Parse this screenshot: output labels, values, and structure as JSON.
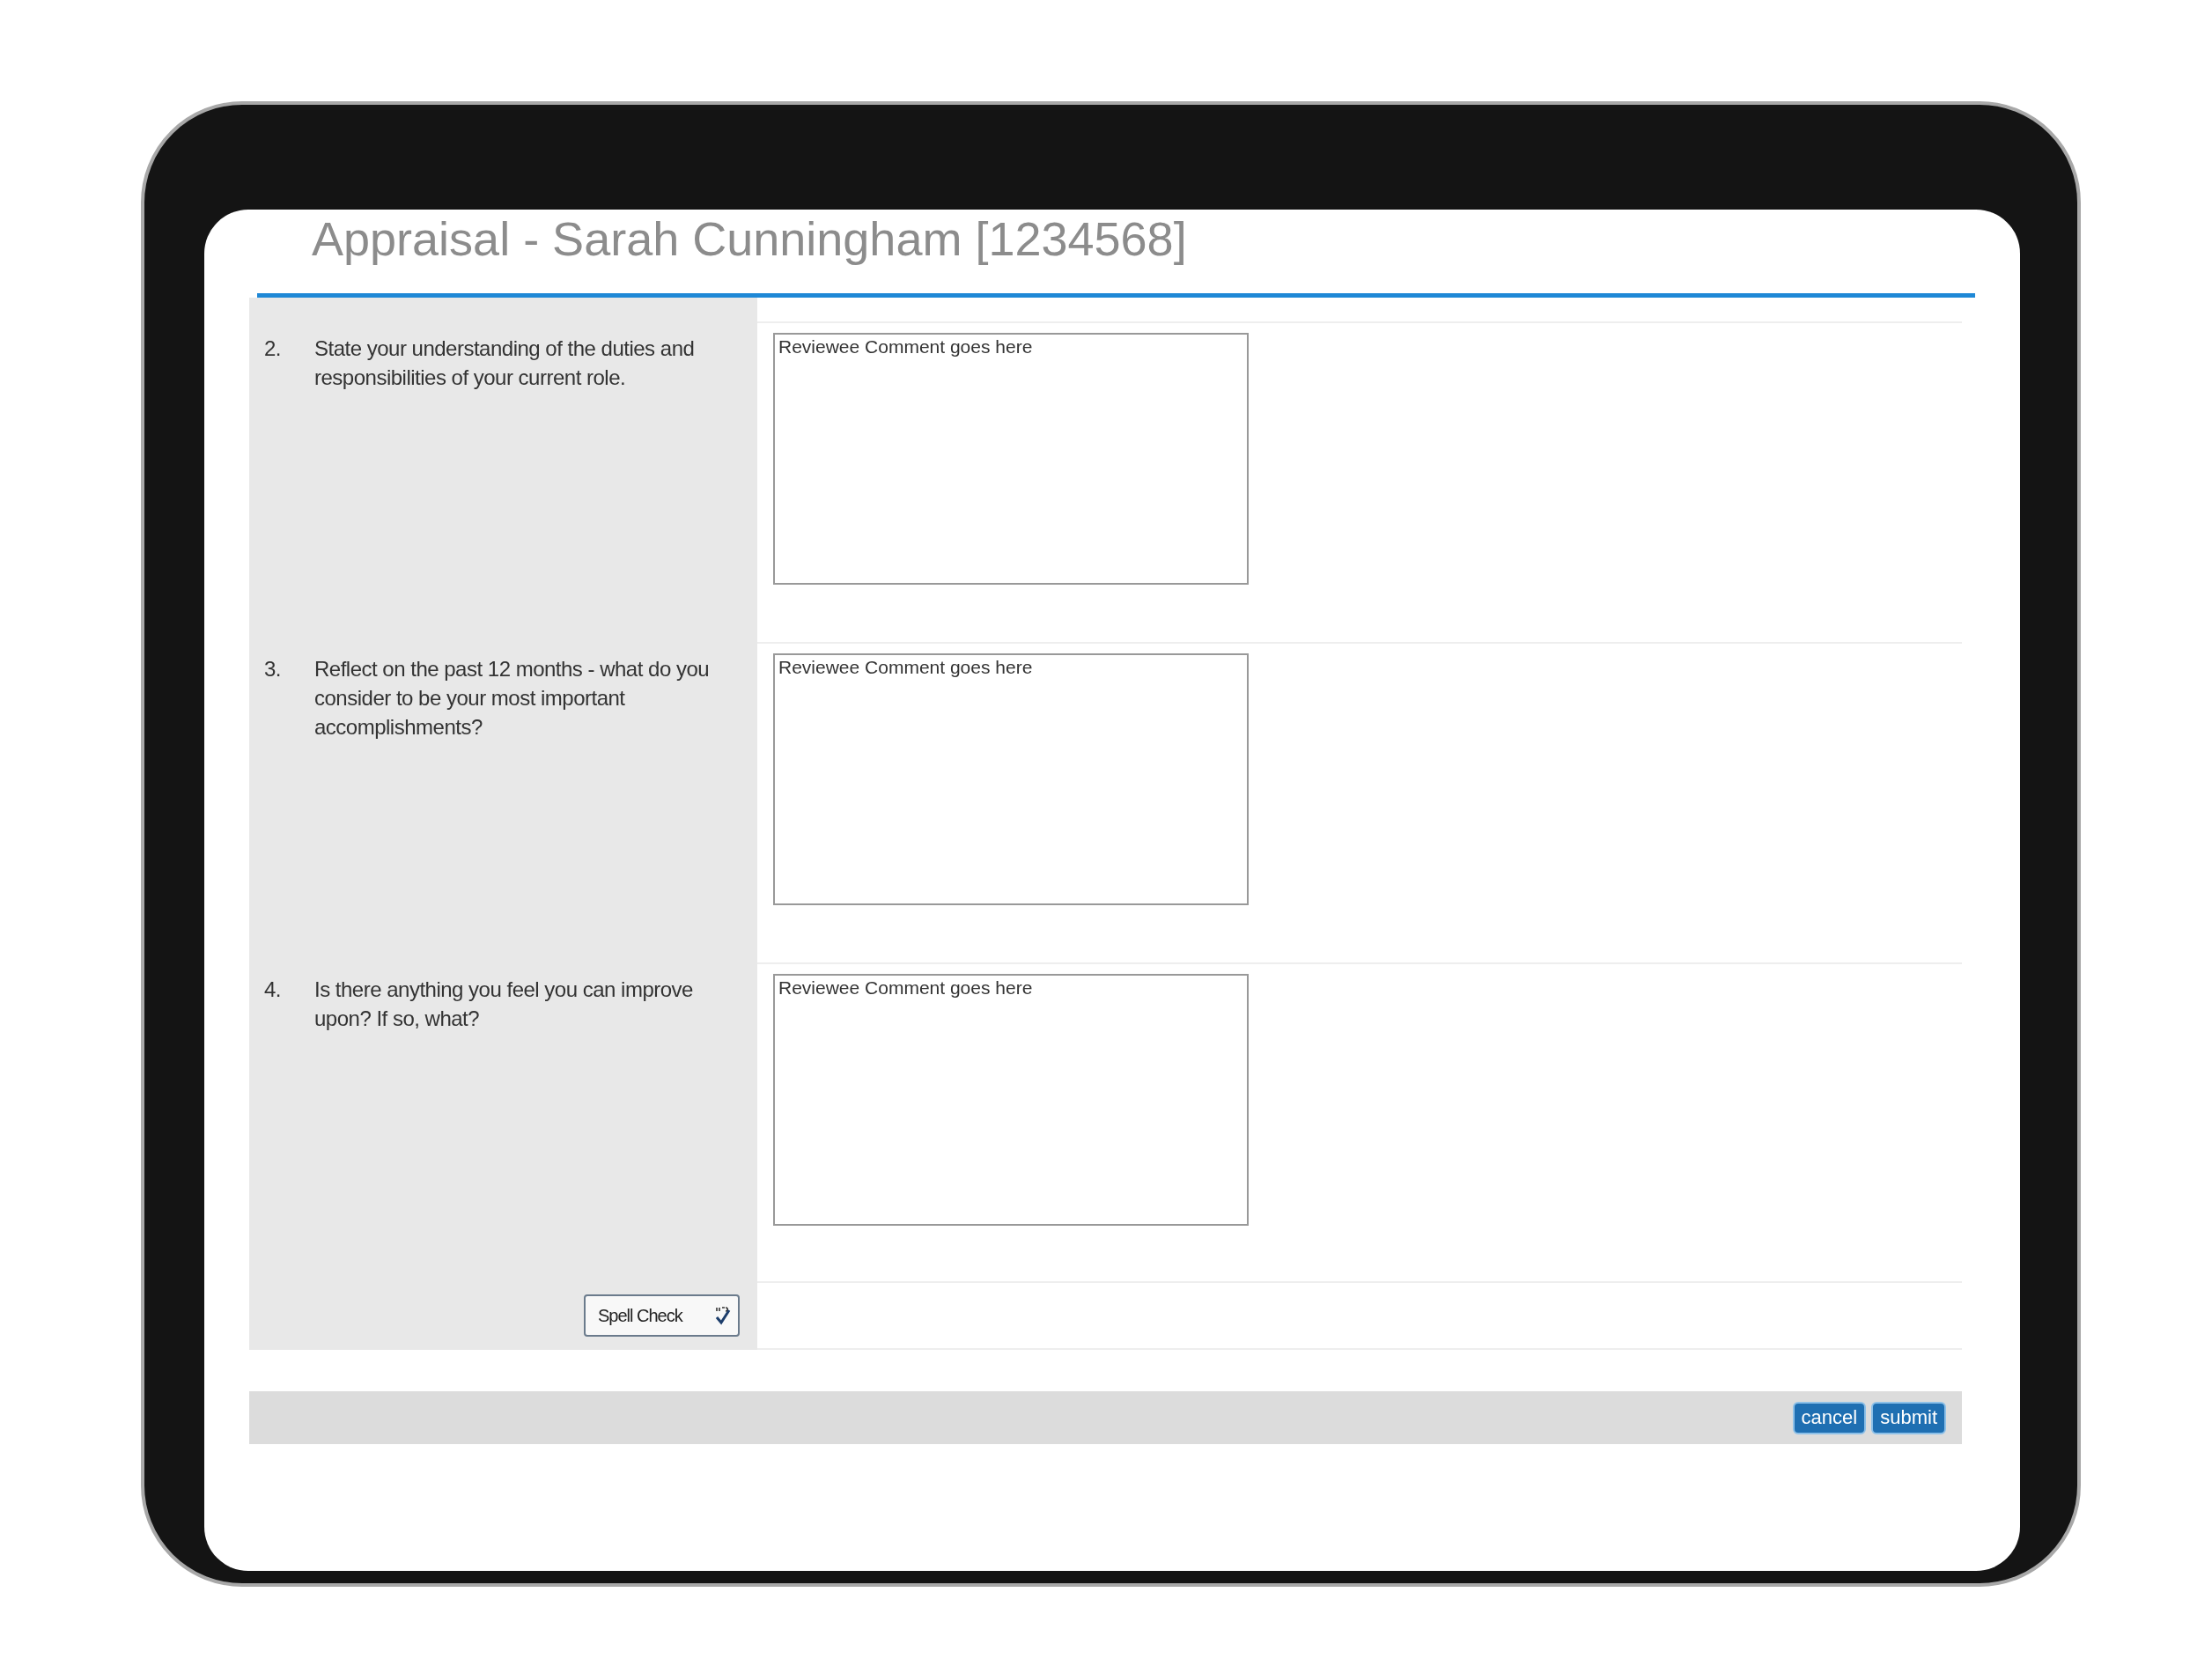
{
  "title": "Appraisal - Sarah Cunningham [1234568]",
  "questions": [
    {
      "number": "2.",
      "text": "State your understanding of the duties and responsibilities of your current role.",
      "placeholder": "Reviewee Comment goes here"
    },
    {
      "number": "3.",
      "text": "Reflect on the past 12 months - what do you consider to be your most important accomplishments?",
      "placeholder": "Reviewee Comment goes here"
    },
    {
      "number": "4.",
      "text": "Is there anything you feel you can improve upon? If so, what?",
      "placeholder": "Reviewee Comment goes here"
    }
  ],
  "spell_check": "Spell Check",
  "buttons": [
    "cancel",
    "submit"
  ]
}
